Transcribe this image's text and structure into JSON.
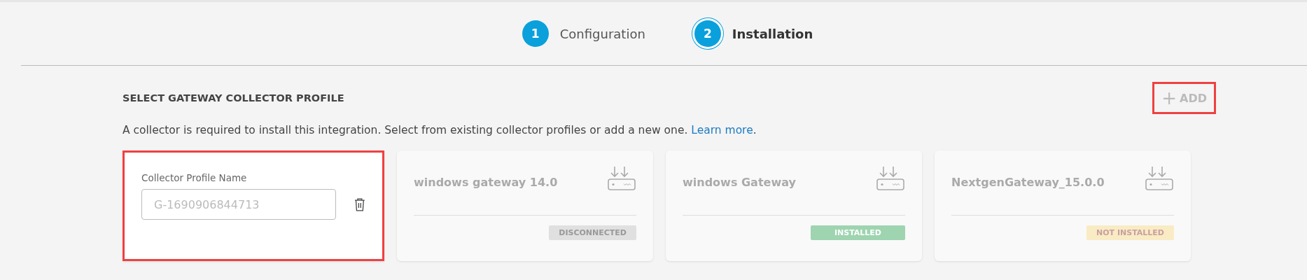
{
  "steps": [
    {
      "number": "1",
      "label": "Configuration",
      "selected": false
    },
    {
      "number": "2",
      "label": "Installation",
      "selected": true
    }
  ],
  "section": {
    "title": "SELECT GATEWAY COLLECTOR PROFILE",
    "add_button": {
      "icon": "+",
      "label": "ADD",
      "highlighted": true
    },
    "description": "A collector is required to install this integration. Select from existing collector profiles or add a new one.",
    "link": "Learn more",
    "after_link": "."
  },
  "new_profile": {
    "label": "Collector Profile Name",
    "placeholder": "G-1690906844713",
    "highlighted": true
  },
  "profiles": [
    {
      "name": "windows gateway 14.0",
      "status": "DISCONNECTED",
      "kind": "disconnected"
    },
    {
      "name": "windows Gateway",
      "status": "INSTALLED",
      "kind": "installed"
    },
    {
      "name": "NextgenGateway_15.0.0",
      "status": "NOT INSTALLED",
      "kind": "not_installed"
    }
  ]
}
